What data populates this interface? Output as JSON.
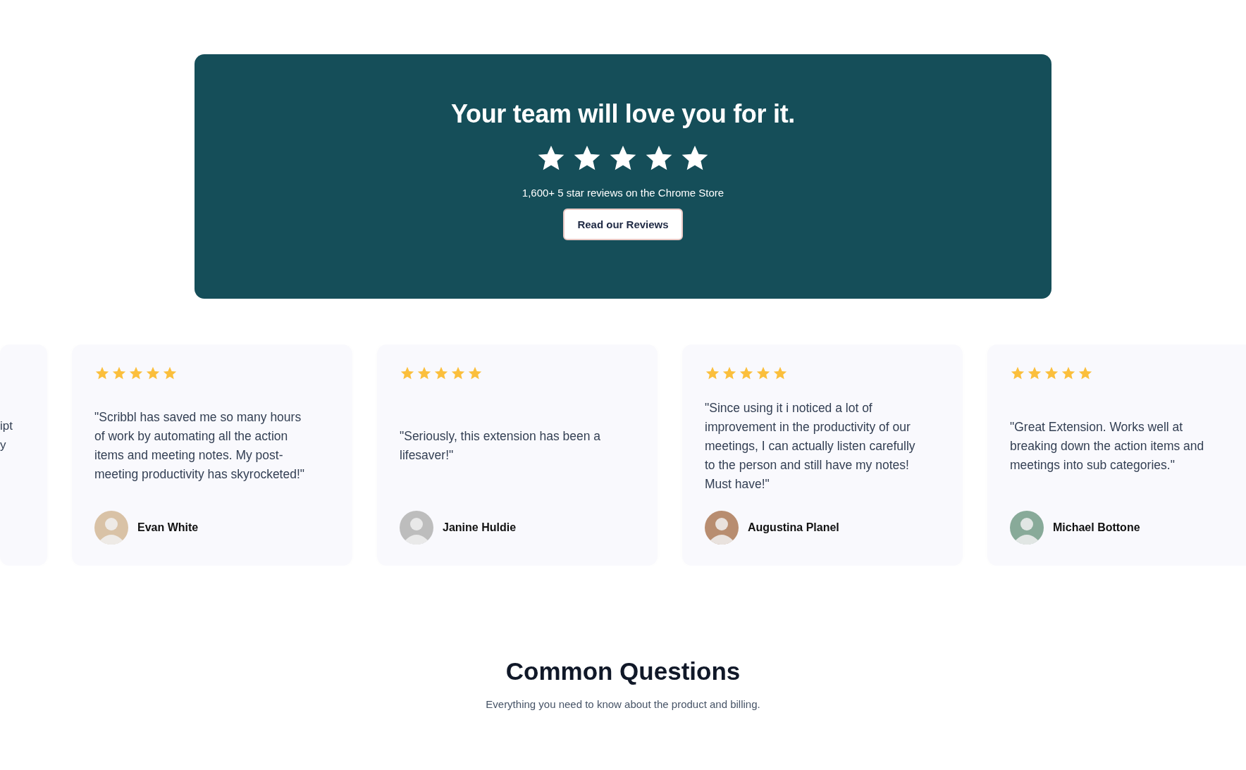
{
  "banner": {
    "title": "Your team will love you for it.",
    "stars": 5,
    "caption": "1,600+ 5 star reviews on the Chrome Store",
    "button": "Read our Reviews"
  },
  "reviews": [
    {
      "kind": "partial",
      "quote_lines": [
        "ipt",
        "y"
      ]
    },
    {
      "kind": "full",
      "stars": 5,
      "quote": "\"Scribbl has saved me so many hours of work by automating all the action items and meeting notes. My post-meeting productivity has skyrocketed!\"",
      "name": "Evan White"
    },
    {
      "kind": "full",
      "stars": 5,
      "quote": "\"Seriously, this extension has been a lifesaver!\"",
      "name": "Janine Huldie"
    },
    {
      "kind": "full",
      "stars": 5,
      "quote": "\"Since using it i noticed a lot of improvement in the productivity of our meetings, I can actually listen carefully to the person and still have my notes! Must have!\"",
      "name": "Augustina Planel"
    },
    {
      "kind": "full",
      "stars": 5,
      "quote": "\"Great Extension.  Works well at breaking down the action items and meetings into sub categories.\"",
      "name": "Michael Bottone"
    }
  ],
  "faq": {
    "title": "Common Questions",
    "subtitle": "Everything you need to know about the product and billing."
  }
}
